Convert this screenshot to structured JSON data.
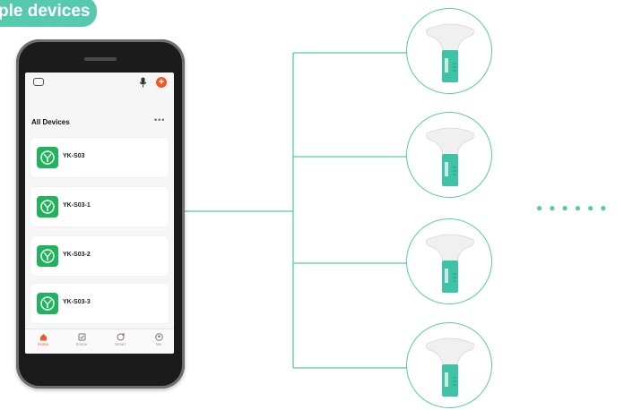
{
  "banner": {
    "text": "ple devices"
  },
  "app": {
    "section_title": "All Devices",
    "devices": [
      {
        "name": "YK-S03"
      },
      {
        "name": "YK-S03-1"
      },
      {
        "name": "YK-S03-2"
      },
      {
        "name": "YK-S03-3"
      }
    ],
    "tabs": [
      {
        "label": "Home",
        "icon": "home-icon",
        "active": true
      },
      {
        "label": "Scene",
        "icon": "scene-icon",
        "active": false
      },
      {
        "label": "Smart",
        "icon": "smart-icon",
        "active": false
      },
      {
        "label": "Me",
        "icon": "profile-icon",
        "active": false
      }
    ]
  },
  "colors": {
    "accent": "#57c9ae",
    "device_icon": "#1fb35b",
    "active_tab": "#f15a24"
  }
}
